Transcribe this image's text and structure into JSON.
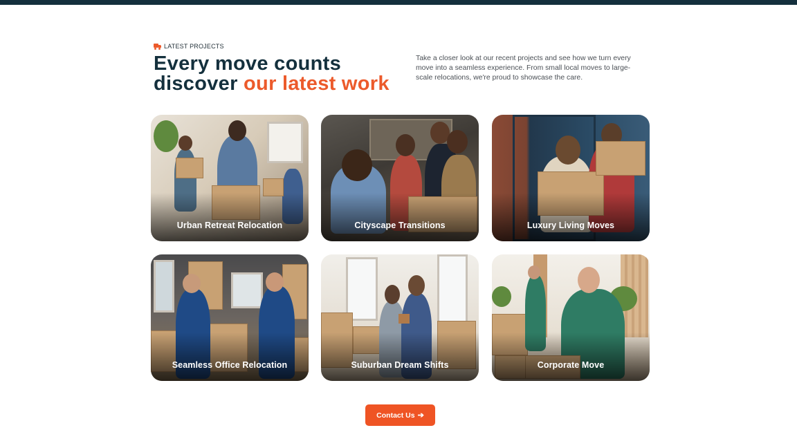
{
  "eyebrow": {
    "icon": "truck-icon",
    "text": "LATEST PROJECTS"
  },
  "heading": {
    "line1": "Every move counts",
    "line2_plain": "discover ",
    "line2_accent": "our latest work"
  },
  "intro": "Take a closer look at our recent projects and see how we turn every move into a seamless experience. From small local moves to large-scale relocations, we're proud to showcase the care.",
  "projects": [
    {
      "title": "Urban Retreat Relocation"
    },
    {
      "title": "Cityscape Transitions"
    },
    {
      "title": "Luxury Living Moves"
    },
    {
      "title": "Seamless Office Relocation"
    },
    {
      "title": "Suburban Dream Shifts"
    },
    {
      "title": "Corporate Move"
    }
  ],
  "cta": {
    "label": "Contact Us",
    "icon": "arrow-right-icon"
  },
  "colors": {
    "navy": "#14303d",
    "accent": "#ec5a2b",
    "button": "#ef5424"
  }
}
